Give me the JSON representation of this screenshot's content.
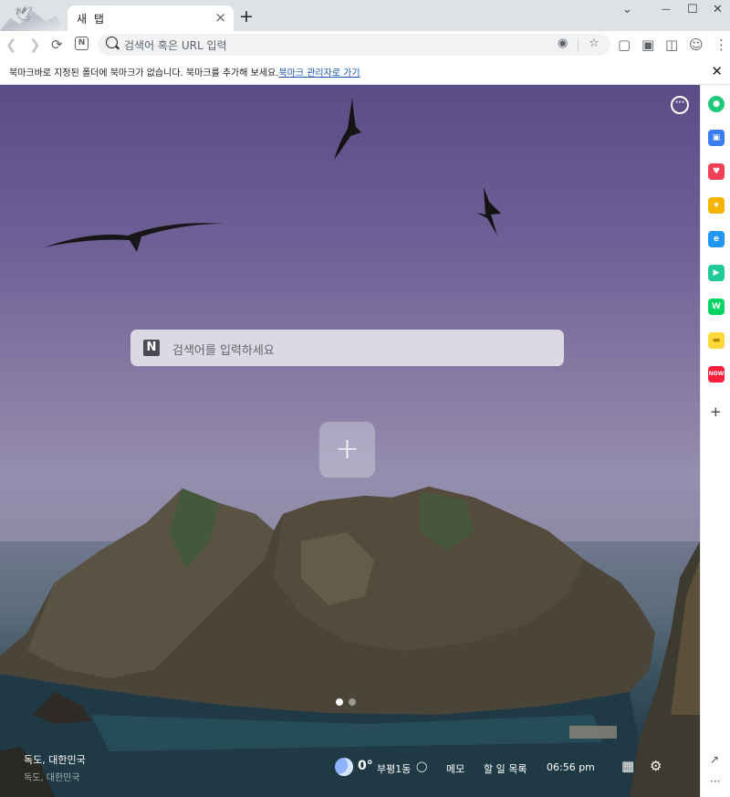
{
  "browser": {
    "tab_title": "새 탭",
    "tab_close": "×",
    "new_tab": "+",
    "window_controls": {
      "dropdown": "⌄",
      "minimize": "—",
      "maximize": "☐",
      "close": "✕"
    },
    "omnibox_placeholder": "검색어 혹은 URL 입력",
    "favicon_letter": "N"
  },
  "bookmark_bar": {
    "message": "북마크바로 지정된 폴더에 북마크가 없습니다. 북마크를 추가해 보세요.",
    "link": "북마크 관리자로 가기",
    "close": "✕"
  },
  "newtab": {
    "search_logo": "N",
    "search_placeholder": "검색어를 입력하세요",
    "add_shortcut": "+",
    "chat_icon": "···",
    "location_primary": "독도, 대한민국",
    "location_secondary": "독도, 대한민국",
    "weather": {
      "temperature": "0°",
      "area": "부평1동"
    },
    "memo": "메모",
    "todo": "할 일 목록",
    "time": "06:56 pm",
    "slides": {
      "total": 2,
      "active": 1
    }
  },
  "sidebar": {
    "items": [
      {
        "name": "green-circle-app",
        "color": "#1ec97a",
        "glyph": "●"
      },
      {
        "name": "naver-calendar-app",
        "color": "#3b7cf0",
        "glyph": "▣"
      },
      {
        "name": "pocket-app",
        "color": "#ef4056",
        "glyph": "♥"
      },
      {
        "name": "favorites-app",
        "color": "#f5b400",
        "glyph": "★"
      },
      {
        "name": "browser-app",
        "color": "#2196f3",
        "glyph": "e"
      },
      {
        "name": "video-player-app",
        "color": "#20c997",
        "glyph": "▶"
      },
      {
        "name": "webtoon-app",
        "color": "#00d564",
        "glyph": "W"
      },
      {
        "name": "memo-app",
        "color": "#ffd83a",
        "glyph": "▬"
      },
      {
        "name": "now-app",
        "color": "#ff1e3c",
        "glyph": "NOW"
      }
    ],
    "add": "+",
    "external": "↗",
    "more": "···"
  }
}
